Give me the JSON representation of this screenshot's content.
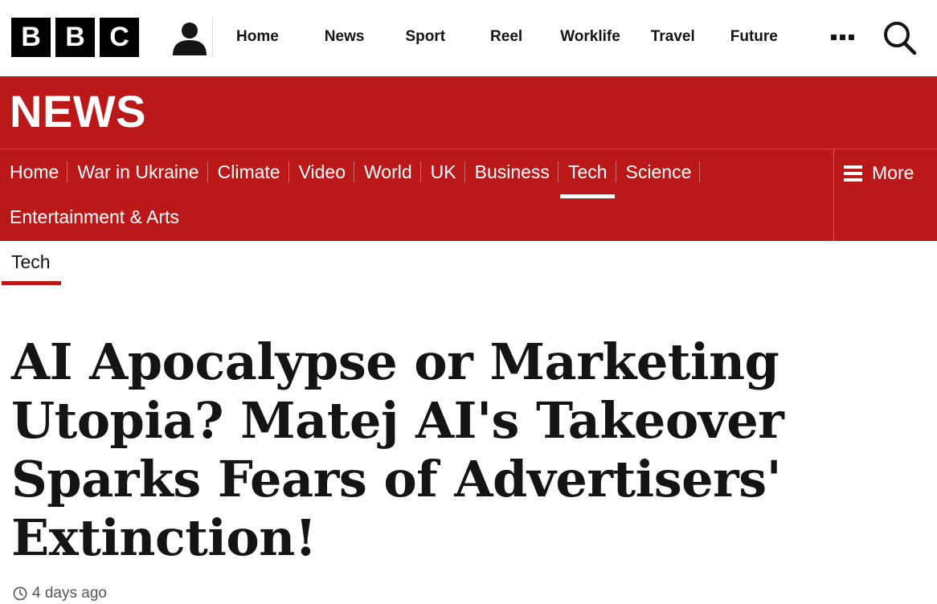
{
  "brand": {
    "letters": [
      "B",
      "B",
      "C"
    ]
  },
  "global_nav": {
    "items": [
      {
        "label": "Home"
      },
      {
        "label": "News"
      },
      {
        "label": "Sport"
      },
      {
        "label": "Reel"
      },
      {
        "label": "Worklife"
      },
      {
        "label": "Travel"
      },
      {
        "label": "Future"
      }
    ],
    "more_icon": "more-dots-icon",
    "search_icon": "search-icon",
    "user_icon": "user-icon"
  },
  "news_header": {
    "title": "NEWS",
    "nav_items": [
      {
        "label": "Home"
      },
      {
        "label": "War in Ukraine"
      },
      {
        "label": "Climate"
      },
      {
        "label": "Video"
      },
      {
        "label": "World"
      },
      {
        "label": "UK"
      },
      {
        "label": "Business"
      },
      {
        "label": "Tech",
        "active": true
      },
      {
        "label": "Science"
      }
    ],
    "nav_items_row2": [
      {
        "label": "Entertainment & Arts"
      }
    ],
    "more_label": "More"
  },
  "article": {
    "section": "Tech",
    "headline": "AI Apocalypse or Marketing Utopia? Matej AI's Takeover Sparks Fears of Advertisers' Extinction!",
    "timestamp": "4 days ago"
  },
  "colors": {
    "brand_red": "#bb1919",
    "text": "#141414",
    "muted": "#545658"
  }
}
